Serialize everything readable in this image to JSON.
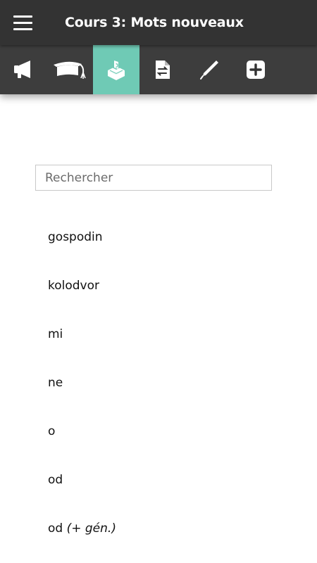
{
  "header": {
    "title": "Cours 3: Mots nouveaux",
    "menu_icon": "hamburger-menu-icon"
  },
  "toolbar": {
    "items": [
      {
        "icon": "megaphone-icon",
        "active": false
      },
      {
        "icon": "graduation-cap-icon",
        "active": false
      },
      {
        "icon": "ballot-box-icon",
        "active": true
      },
      {
        "icon": "document-swap-icon",
        "active": false
      },
      {
        "icon": "pen-icon",
        "active": false
      },
      {
        "icon": "plus-square-icon",
        "active": false
      }
    ],
    "active_color": "#6fcab5",
    "background_color": "#3d3d3d"
  },
  "search": {
    "placeholder": "Rechercher",
    "value": ""
  },
  "words": [
    {
      "text": "gospodin",
      "note": ""
    },
    {
      "text": "kolodvor",
      "note": ""
    },
    {
      "text": "mi",
      "note": ""
    },
    {
      "text": "ne",
      "note": ""
    },
    {
      "text": "o",
      "note": ""
    },
    {
      "text": "od",
      "note": ""
    },
    {
      "text": "od",
      "note": "(+ gén.)"
    }
  ]
}
